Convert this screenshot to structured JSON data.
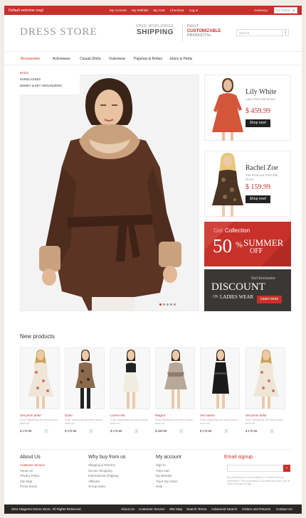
{
  "topbar": {
    "welcome": "Default welcome msg!",
    "links": [
      "My Account",
      "My Wishlist",
      "My Cart",
      "Checkout",
      "Log In"
    ],
    "currency_label": "Currency:",
    "currency_value": "US Dollar"
  },
  "header": {
    "logo": "DRESS STORE",
    "ship_line1": "FREE WORLDWIDE",
    "ship_line2": "SHIPPING",
    "custom_line1": "FULLY",
    "custom_line2": "CUSTOMIZABLE",
    "custom_line3": "PRODUCTS»",
    "search_placeholder": "Search",
    "search_button": "›"
  },
  "nav": {
    "items": [
      "Accessories",
      "Activewear",
      "Casual Shirts",
      "Outerwear",
      "Pajamas & Robes",
      "Jeans & Pants"
    ],
    "submenu": [
      "BAGS",
      "SUNGLASSES",
      "MONEY & KEY ORGANIZERS"
    ]
  },
  "slider": {
    "dots": 5,
    "active_dot": 0
  },
  "side_products": [
    {
      "name": "Lily White",
      "desc": "Lace Print Silk Dress",
      "price": "$ 459.99",
      "button": "Shop now!"
    },
    {
      "name": "Rachel Zoe",
      "desc": "Zoe Peacock Print Silk Dress",
      "price": "$ 159.99",
      "button": "Shop now!"
    }
  ],
  "banners": {
    "summer_get": "Get",
    "summer_collection": "Collection",
    "summer_percent": "50",
    "summer_pct_sign": "%",
    "summer_word": "SUMMER",
    "summer_off": "OFF",
    "discount_get": "Get Exclusive",
    "discount_word": "DISCOUNT",
    "discount_on": "ON",
    "discount_ladies": "LADIES WEAR",
    "discount_button": "Learn more"
  },
  "new_products": {
    "title": "New products",
    "items": [
      {
        "name": "Set proin dolor",
        "desc": "Dolor adipiscing elit lorem ipsum dolor sit",
        "price": "$ 179.99"
      },
      {
        "name": "Dolor",
        "desc": "Dolor adipiscing elit lorem ipsum dolor sit",
        "price": "$ 175.99"
      },
      {
        "name": "Lorem set",
        "desc": "Dolor adipiscing elit lorem ipsum dolor sit",
        "price": "$ 179.99"
      },
      {
        "name": "Magna",
        "desc": "Dolor adipiscing elit lorem ipsum dolor sit",
        "price": "$ 329.99"
      },
      {
        "name": "Set autem",
        "desc": "Dolor adipiscing elit lorem ipsum dolor sit",
        "price": "$ 179.99"
      },
      {
        "name": "Set proin dolor",
        "desc": "Dolor adipiscing elit lorem ipsum dolor sit",
        "price": "$ 179.99"
      }
    ]
  },
  "footer": {
    "about": {
      "title": "About Us",
      "links": [
        "Customer Service",
        "About Us",
        "Privacy Policy",
        "Site Map",
        "Press Room"
      ]
    },
    "why": {
      "title": "Why buy from us",
      "links": [
        "Shipping & Returns",
        "Secure Shopping",
        "International Shipping",
        "Affiliates",
        "Group Sales"
      ]
    },
    "account": {
      "title": "My account",
      "links": [
        "Sign In",
        "View Cart",
        "My Wishlist",
        "Track My Order",
        "Help"
      ]
    },
    "signup": {
      "title": "Email signup",
      "button": "›",
      "note": "By entering your email address, I confirm that the information I am providing is accurate and that I am at least 18 years of age."
    }
  },
  "bottombar": {
    "copyright": "2011 Magento Demo Store. All Rights Reserved.",
    "links": [
      "About Us",
      "Customer Service",
      "Site Map",
      "Search Terms",
      "Advanced Search",
      "Orders and Returns",
      "Contact Us"
    ]
  },
  "colors": {
    "accent": "#c8302a",
    "dark": "#2a2827",
    "coat": "#5b3424"
  }
}
